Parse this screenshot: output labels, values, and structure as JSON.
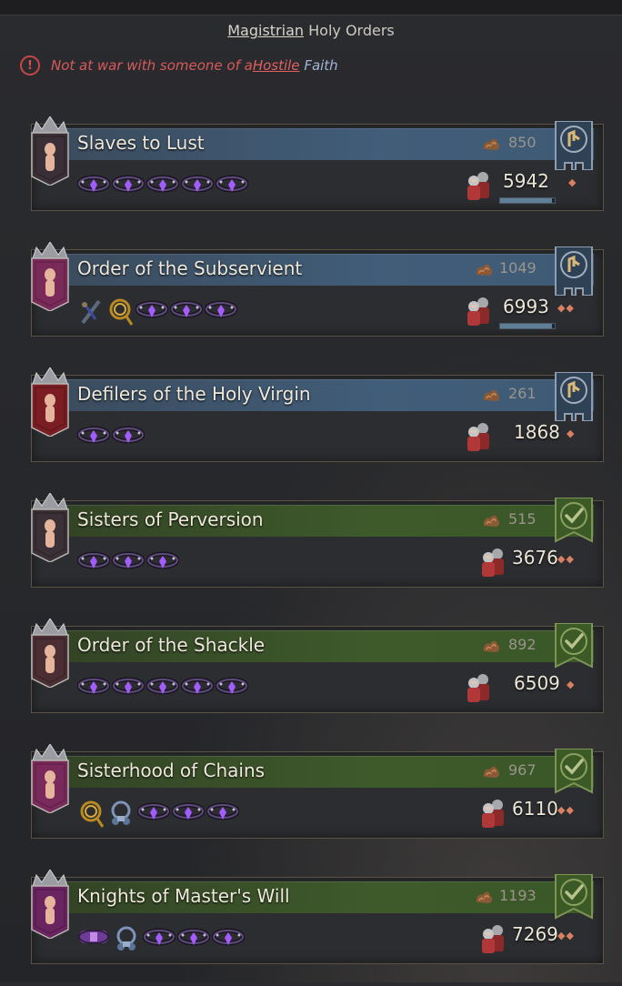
{
  "header": {
    "title_link": "Magistrian",
    "title_rest": "Holy Orders"
  },
  "warning": {
    "prefix": "Not at war with someone of a ",
    "link": "Hostile",
    "suffix": "Faith"
  },
  "colors": {
    "blue_bar": "#415d79",
    "green_bar": "#3e5a2a",
    "warning": "#d65a5a",
    "faith_link": "#9fb6d6",
    "pip": "#d98060"
  },
  "orders": [
    {
      "name": "Slaves to Lust",
      "gold": "850",
      "troops": "5942",
      "pips": "◆",
      "status": "hireable",
      "status_icon": "hire-icon",
      "items": [
        "collar",
        "collar",
        "collar",
        "collar",
        "collar"
      ],
      "progress": 0.95
    },
    {
      "name": "Order of the Subservient",
      "gold": "1049",
      "troops": "6993",
      "pips": "◆◆",
      "status": "hireable",
      "status_icon": "hire-icon",
      "items": [
        "flail",
        "whip",
        "collar",
        "collar",
        "collar"
      ],
      "progress": 0.95
    },
    {
      "name": "Defilers of the Holy Virgin",
      "gold": "261",
      "troops": "1868",
      "pips": "◆",
      "status": "hireable",
      "status_icon": "hire-icon",
      "items": [
        "collar",
        "collar"
      ],
      "progress": null
    },
    {
      "name": "Sisters of Perversion",
      "gold": "515",
      "troops": "3676",
      "pips": "◆◆",
      "status": "hired",
      "status_icon": "checkmark-icon",
      "items": [
        "collar",
        "collar",
        "collar"
      ],
      "progress": null
    },
    {
      "name": "Order of the Shackle",
      "gold": "892",
      "troops": "6509",
      "pips": "◆",
      "status": "hired",
      "status_icon": "checkmark-icon",
      "items": [
        "collar",
        "collar",
        "collar",
        "collar",
        "collar"
      ],
      "progress": null
    },
    {
      "name": "Sisterhood of Chains",
      "gold": "967",
      "troops": "6110",
      "pips": "◆◆",
      "status": "hired",
      "status_icon": "checkmark-icon",
      "items": [
        "whip",
        "shackle",
        "collar",
        "collar",
        "collar"
      ],
      "progress": null
    },
    {
      "name": "Knights of Master's Will",
      "gold": "1193",
      "troops": "7269",
      "pips": "◆◆",
      "status": "hired",
      "status_icon": "checkmark-icon",
      "items": [
        "belt",
        "shackle",
        "collar",
        "collar",
        "collar"
      ],
      "progress": null
    }
  ]
}
